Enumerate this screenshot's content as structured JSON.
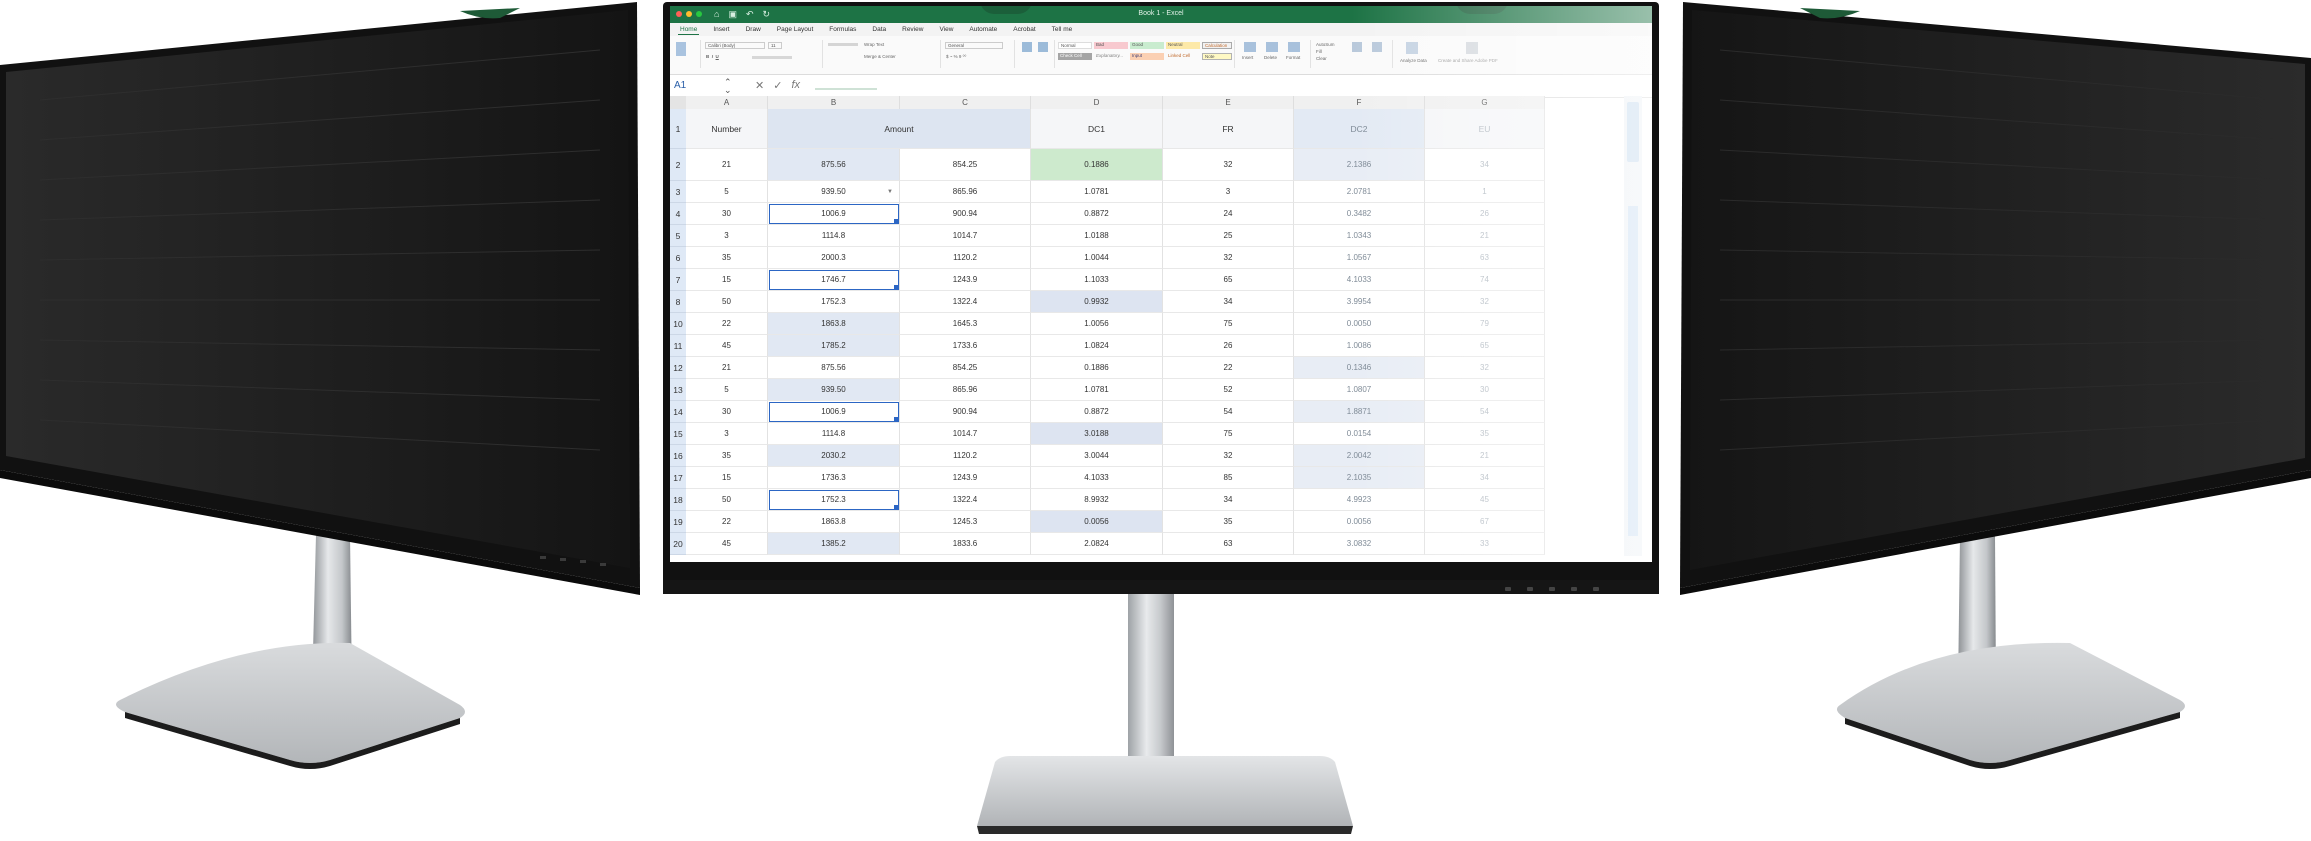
{
  "titlebar": {
    "document_title": "Book 1 - Excel",
    "qa_icons": [
      "home-icon",
      "save-icon",
      "undo-icon",
      "redo-icon"
    ],
    "colors": {
      "accent": "#1d7345"
    }
  },
  "tabs": [
    "Home",
    "Insert",
    "Draw",
    "Page Layout",
    "Formulas",
    "Data",
    "Review",
    "View",
    "Automate",
    "Acrobat",
    "Tell me"
  ],
  "ribbon": {
    "font_name": "Calibri (Body)",
    "font_size": "11",
    "number_format": "General",
    "wrap_text": "Wrap Text",
    "merge_center": "Merge & Center",
    "conditional_formatting": "Conditional Formatting",
    "format_as_table": "Format as Table",
    "styles": [
      "Normal",
      "Bad",
      "Good",
      "Neutral",
      "Calculation",
      "Check Cell",
      "Explanatory...",
      "Input",
      "Linked Cell",
      "Note"
    ],
    "cells": [
      "Insert",
      "Delete",
      "Format"
    ],
    "editing": [
      "AutoSum",
      "Fill",
      "Clear",
      "Sort & Filter",
      "Find & Select"
    ],
    "analyze": "Analyze Data",
    "create_pdf": "Create and Share Adobe PDF"
  },
  "formula_bar": {
    "name_box": "A1",
    "fx": "fx"
  },
  "sheet": {
    "columns": [
      "A",
      "B",
      "C",
      "D",
      "E",
      "F",
      "G"
    ],
    "header_row": {
      "number": "1",
      "A": "Number",
      "BC": "Amount",
      "D": "DC1",
      "E": "FR",
      "F": "DC2",
      "G": "EU"
    },
    "rows": [
      {
        "n": "2",
        "A": "21",
        "B": "875.56",
        "C": "854.25",
        "D": "0.1886",
        "E": "32",
        "F": "2.1386",
        "G": "34"
      },
      {
        "n": "3",
        "A": "5",
        "B": "939.50",
        "C": "865.96",
        "D": "1.0781",
        "E": "3",
        "F": "2.0781",
        "G": "1"
      },
      {
        "n": "4",
        "A": "30",
        "B": "1006.9",
        "C": "900.94",
        "D": "0.8872",
        "E": "24",
        "F": "0.3482",
        "G": "26"
      },
      {
        "n": "5",
        "A": "3",
        "B": "1114.8",
        "C": "1014.7",
        "D": "1.0188",
        "E": "25",
        "F": "1.0343",
        "G": "21"
      },
      {
        "n": "6",
        "A": "35",
        "B": "2000.3",
        "C": "1120.2",
        "D": "1.0044",
        "E": "32",
        "F": "1.0567",
        "G": "63"
      },
      {
        "n": "7",
        "A": "15",
        "B": "1746.7",
        "C": "1243.9",
        "D": "1.1033",
        "E": "65",
        "F": "4.1033",
        "G": "74"
      },
      {
        "n": "8",
        "A": "50",
        "B": "1752.3",
        "C": "1322.4",
        "D": "0.9932",
        "E": "34",
        "F": "3.9954",
        "G": "32"
      },
      {
        "n": "10",
        "A": "22",
        "B": "1863.8",
        "C": "1645.3",
        "D": "1.0056",
        "E": "75",
        "F": "0.0050",
        "G": "79"
      },
      {
        "n": "11",
        "A": "45",
        "B": "1785.2",
        "C": "1733.6",
        "D": "1.0824",
        "E": "26",
        "F": "1.0086",
        "G": "65"
      },
      {
        "n": "12",
        "A": "21",
        "B": "875.56",
        "C": "854.25",
        "D": "0.1886",
        "E": "22",
        "F": "0.1346",
        "G": "32"
      },
      {
        "n": "13",
        "A": "5",
        "B": "939.50",
        "C": "865.96",
        "D": "1.0781",
        "E": "52",
        "F": "1.0807",
        "G": "30"
      },
      {
        "n": "14",
        "A": "30",
        "B": "1006.9",
        "C": "900.94",
        "D": "0.8872",
        "E": "54",
        "F": "1.8871",
        "G": "54"
      },
      {
        "n": "15",
        "A": "3",
        "B": "1114.8",
        "C": "1014.7",
        "D": "3.0188",
        "E": "75",
        "F": "0.0154",
        "G": "35"
      },
      {
        "n": "16",
        "A": "35",
        "B": "2030.2",
        "C": "1120.2",
        "D": "3.0044",
        "E": "32",
        "F": "2.0042",
        "G": "21"
      },
      {
        "n": "17",
        "A": "15",
        "B": "1736.3",
        "C": "1243.9",
        "D": "4.1033",
        "E": "85",
        "F": "2.1035",
        "G": "34"
      },
      {
        "n": "18",
        "A": "50",
        "B": "1752.3",
        "C": "1322.4",
        "D": "8.9932",
        "E": "34",
        "F": "4.9923",
        "G": "45"
      },
      {
        "n": "19",
        "A": "22",
        "B": "1863.8",
        "C": "1245.3",
        "D": "0.0056",
        "E": "35",
        "F": "0.0056",
        "G": "67"
      },
      {
        "n": "20",
        "A": "45",
        "B": "1385.2",
        "C": "1833.6",
        "D": "2.0824",
        "E": "63",
        "F": "3.0832",
        "G": "33"
      }
    ]
  }
}
